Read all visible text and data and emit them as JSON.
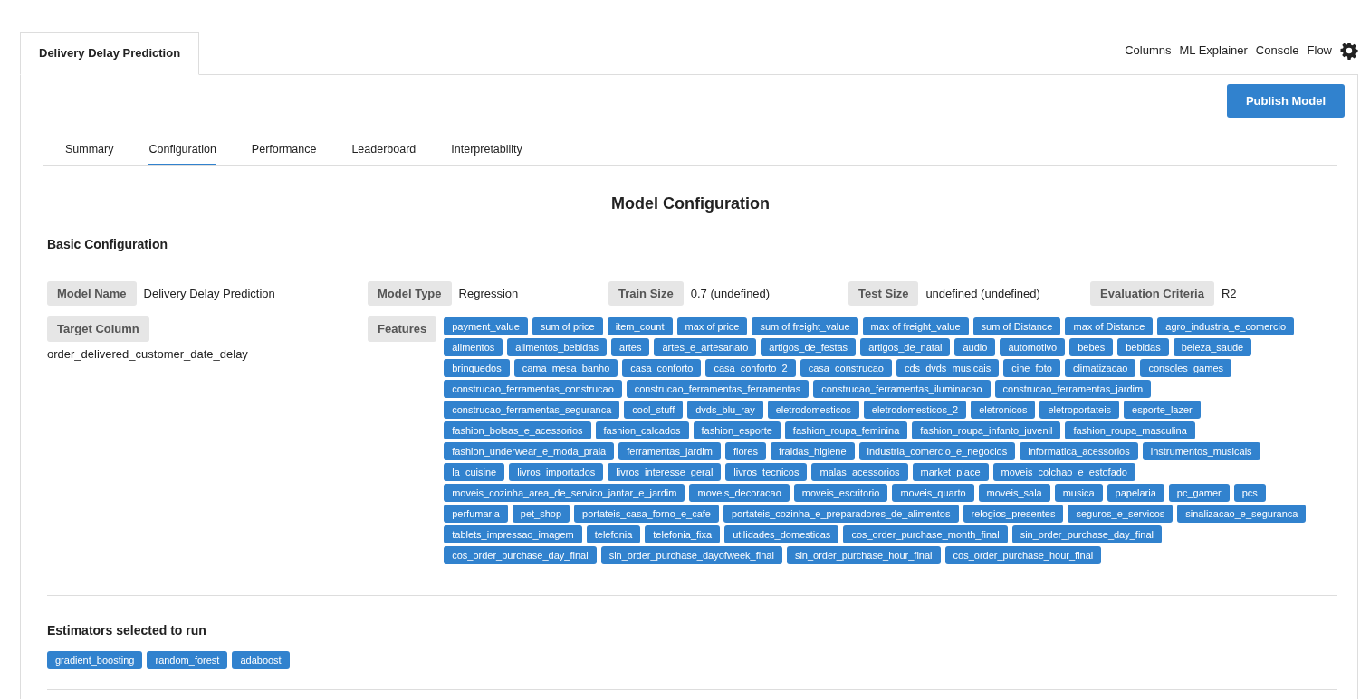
{
  "header_tab": {
    "label": "Delivery Delay Prediction",
    "selected": true
  },
  "top_links": [
    "Columns",
    "ML Explainer",
    "Console",
    "Flow"
  ],
  "publish_button": "Publish Model",
  "tabs": [
    {
      "label": "Summary",
      "selected": false
    },
    {
      "label": "Configuration",
      "selected": true
    },
    {
      "label": "Performance",
      "selected": false
    },
    {
      "label": "Leaderboard",
      "selected": false
    },
    {
      "label": "Interpretability",
      "selected": false
    }
  ],
  "title": "Model Configuration",
  "basic_configuration": {
    "heading": "Basic Configuration",
    "fields": [
      {
        "label": "Model Name",
        "value": "Delivery Delay Prediction"
      },
      {
        "label": "Model Type",
        "value": "Regression"
      },
      {
        "label": "Train Size",
        "value": "0.7 (undefined)"
      },
      {
        "label": "Test Size",
        "value": "undefined (undefined)"
      },
      {
        "label": "Evaluation Criteria",
        "value": "R2"
      }
    ]
  },
  "target_column": {
    "label": "Target Column",
    "value": "order_delivered_customer_date_delay"
  },
  "features": {
    "label": "Features",
    "tags": [
      "payment_value",
      "sum of price",
      "item_count",
      "max of price",
      "sum of freight_value",
      "max of freight_value",
      "sum of Distance",
      "max of Distance",
      "agro_industria_e_comercio",
      "alimentos",
      "alimentos_bebidas",
      "artes",
      "artes_e_artesanato",
      "artigos_de_festas",
      "artigos_de_natal",
      "audio",
      "automotivo",
      "bebes",
      "bebidas",
      "beleza_saude",
      "brinquedos",
      "cama_mesa_banho",
      "casa_conforto",
      "casa_conforto_2",
      "casa_construcao",
      "cds_dvds_musicais",
      "cine_foto",
      "climatizacao",
      "consoles_games",
      "construcao_ferramentas_construcao",
      "construcao_ferramentas_ferramentas",
      "construcao_ferramentas_iluminacao",
      "construcao_ferramentas_jardim",
      "construcao_ferramentas_seguranca",
      "cool_stuff",
      "dvds_blu_ray",
      "eletrodomesticos",
      "eletrodomesticos_2",
      "eletronicos",
      "eletroportateis",
      "esporte_lazer",
      "fashion_bolsas_e_acessorios",
      "fashion_calcados",
      "fashion_esporte",
      "fashion_roupa_feminina",
      "fashion_roupa_infanto_juvenil",
      "fashion_roupa_masculina",
      "fashion_underwear_e_moda_praia",
      "ferramentas_jardim",
      "flores",
      "fraldas_higiene",
      "industria_comercio_e_negocios",
      "informatica_acessorios",
      "instrumentos_musicais",
      "la_cuisine",
      "livros_importados",
      "livros_interesse_geral",
      "livros_tecnicos",
      "malas_acessorios",
      "market_place",
      "moveis_colchao_e_estofado",
      "moveis_cozinha_area_de_servico_jantar_e_jardim",
      "moveis_decoracao",
      "moveis_escritorio",
      "moveis_quarto",
      "moveis_sala",
      "musica",
      "papelaria",
      "pc_gamer",
      "pcs",
      "perfumaria",
      "pet_shop",
      "portateis_casa_forno_e_cafe",
      "portateis_cozinha_e_preparadores_de_alimentos",
      "relogios_presentes",
      "seguros_e_servicos",
      "sinalizacao_e_seguranca",
      "tablets_impressao_imagem",
      "telefonia",
      "telefonia_fixa",
      "utilidades_domesticas",
      "cos_order_purchase_month_final",
      "sin_order_purchase_day_final",
      "cos_order_purchase_day_final",
      "sin_order_purchase_dayofweek_final",
      "sin_order_purchase_hour_final",
      "cos_order_purchase_hour_final"
    ]
  },
  "estimators": {
    "heading": "Estimators selected to run",
    "tags": [
      "gradient_boosting",
      "random_forest",
      "adaboost"
    ]
  }
}
